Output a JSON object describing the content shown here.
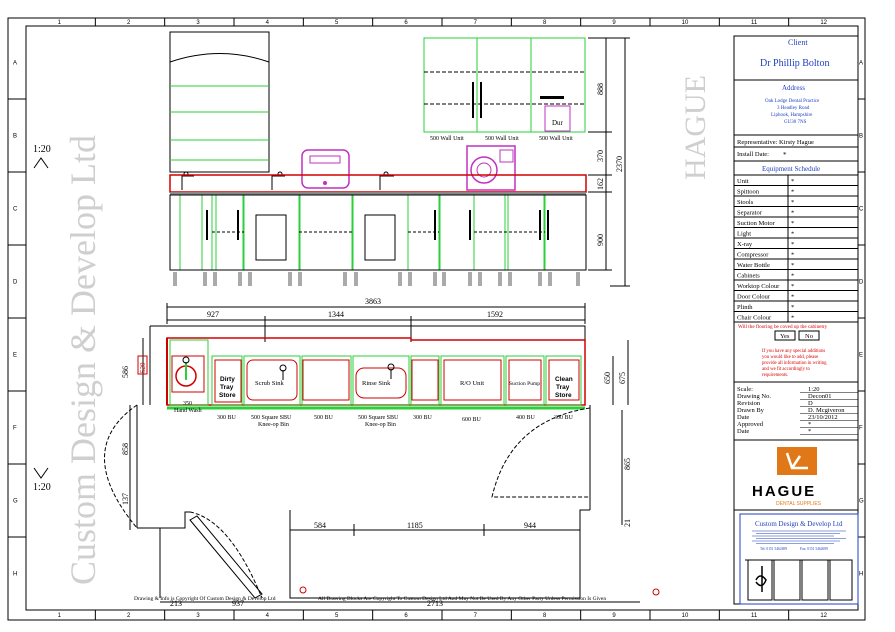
{
  "border": {
    "columns": [
      "1",
      "2",
      "3",
      "4",
      "5",
      "6",
      "7",
      "8",
      "9",
      "10",
      "11",
      "12"
    ],
    "rows": [
      "A",
      "B",
      "C",
      "D",
      "E",
      "F",
      "G",
      "H"
    ]
  },
  "watermarks": {
    "left": "Custom Design & Develop Ltd",
    "right": "HAGUE"
  },
  "scales": {
    "elevation": "1:20",
    "plan": "1:20"
  },
  "elevation": {
    "wall_units": [
      "500 Wall Unit",
      "500 Wall Unit",
      "500 Wall Unit"
    ],
    "dur_label": "Dur",
    "dims": {
      "wall": "888",
      "gap": "370",
      "worktop": "162",
      "base": "900",
      "total": "2370"
    }
  },
  "plan": {
    "overall_width": "3863",
    "top_dims": [
      "927",
      "1344",
      "1592"
    ],
    "left_dims": {
      "depth_a": "586",
      "depth_b": "520",
      "side_858": "858",
      "side_137": "137"
    },
    "right_dims": {
      "d650": "650",
      "d675": "675",
      "d865": "865",
      "d21": "21"
    },
    "bottom_dims": [
      "584",
      "1185",
      "944"
    ],
    "bottom_outer": {
      "left": "213",
      "mid": "937",
      "right": "2713"
    },
    "units_in_plan": {
      "dirty_tray": [
        "Dirty",
        "Tray",
        "Store"
      ],
      "scrub_sink": "Scrub Sink",
      "rinse_sink": "Rinse Sink",
      "ro_unit": "R/O Unit",
      "suction_pump": "Suction Pump",
      "clean_tray": [
        "Clean",
        "Tray",
        "Store"
      ]
    },
    "unit_labels": {
      "hand_wash": [
        "350",
        "Hand Wash"
      ],
      "bu300a": "300 BU",
      "sq500a": [
        "500 Square SBU",
        "Knee-op Bin"
      ],
      "bu500": "500 BU",
      "sq500b": [
        "500 Square SBU",
        "Knee-op Bin"
      ],
      "bu300b": "300 BU",
      "bu600": "600 BU",
      "bu400": "400 BU",
      "bu300c": "300 BU"
    }
  },
  "copyright": {
    "left": "Drawing & Info is Copyright Of Custom Design & Develop Ltd",
    "right": "All Drawing Blocks Are Copyright To Custom Design Ltd And May Not Be Used By Any Other Party Unless Permission Is Given"
  },
  "title_block": {
    "client_heading": "Client",
    "client_name": "Dr Phillip Bolton",
    "address_heading": "Address",
    "address_lines": [
      "Oak Lodge Dental Practice",
      "3 Headley Road",
      "Liphook, Hampshire",
      "GU30 7NS"
    ],
    "representative": "Representative:  Kirsty Hague",
    "install_date_label": "Install Date:",
    "install_date_value": "*",
    "schedule_heading": "Equipment Schedule",
    "schedule": [
      {
        "item": "Unit",
        "value": "*"
      },
      {
        "item": "Spittoon",
        "value": "*"
      },
      {
        "item": "Stools",
        "value": "*"
      },
      {
        "item": "Separator",
        "value": "*"
      },
      {
        "item": "Suction Motor",
        "value": "*"
      },
      {
        "item": "Light",
        "value": "*"
      },
      {
        "item": "X-ray",
        "value": "*"
      },
      {
        "item": "Compressor",
        "value": "*"
      },
      {
        "item": "Water Bottle",
        "value": "*"
      },
      {
        "item": "Cabinets",
        "value": "*"
      },
      {
        "item": "Worktop Colour",
        "value": "*"
      },
      {
        "item": "Door Colour",
        "value": "*"
      },
      {
        "item": "Plinth",
        "value": "*"
      },
      {
        "item": "Chair Colour",
        "value": "*"
      }
    ],
    "flooring_question": "Will the flooring be coved up the cabinetry",
    "yes": "Yes",
    "no": "No",
    "note_lines": [
      "If you have any special additions",
      "you would like to add, please",
      "provide all information in writing",
      "and we fit accordingly to",
      "requirements."
    ],
    "meta": [
      {
        "label": "Scale:",
        "value": "1:20"
      },
      {
        "label": "Drawing No.",
        "value": "Decon01"
      },
      {
        "label": "Revision",
        "value": "D"
      },
      {
        "label": "Drawn By",
        "value": "D. Mcgiveron"
      },
      {
        "label": "Date",
        "value": "23/10/2012"
      },
      {
        "label": "Approved",
        "value": "*"
      },
      {
        "label": "Date",
        "value": "*"
      }
    ],
    "logo": {
      "name": "HAGUE",
      "sub": "DENTAL SUPPLIES",
      "accent": "#e07818"
    },
    "company": {
      "name": "Custom Design & Develop Ltd",
      "tel": "Tel: 0151 5462699",
      "fax": "Fax: 0151 5462699"
    }
  },
  "colors": {
    "green": "#2bcf3a",
    "red": "#d00000",
    "magenta": "#c030c0",
    "blue": "#1f3fbf",
    "orange": "#e07818"
  }
}
